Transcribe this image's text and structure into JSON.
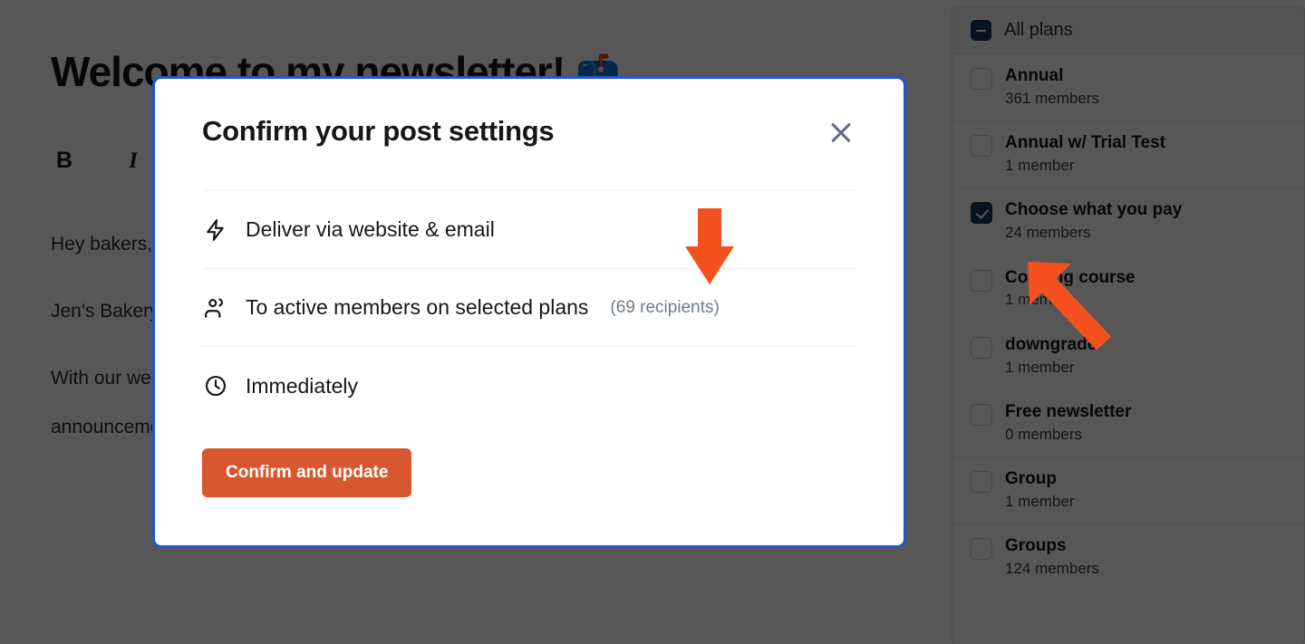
{
  "editor": {
    "post_title": "Welcome to my newsletter!",
    "post_title_emoji": "📫",
    "toolbar": {
      "bold": "B",
      "italic": "I"
    },
    "paragraphs": [
      "Hey bakers,",
      "Jen's Bakery is your go-to resource for simple recipes that get shared across the website.",
      "With our weekly newsletter, you'll never miss out on new recipes, discussions, or announcements."
    ]
  },
  "modal": {
    "title": "Confirm your post settings",
    "close_label": "Close",
    "settings": [
      {
        "icon": "lightning-bolt-icon",
        "label": "Deliver via website & email",
        "sub": ""
      },
      {
        "icon": "members-icon",
        "label": "To active members on selected plans",
        "sub": "(69 recipients)"
      },
      {
        "icon": "clock-icon",
        "label": "Immediately",
        "sub": ""
      }
    ],
    "confirm_button": "Confirm and update",
    "border_color": "#1f56d6",
    "button_color": "#d9572f"
  },
  "sidebar": {
    "header": {
      "label": "All plans",
      "checkbox_state": "indeterminate"
    },
    "plans": [
      {
        "name": "Annual",
        "members": "361 members",
        "checked": false
      },
      {
        "name": "Annual w/ Trial Test",
        "members": "1 member",
        "checked": false
      },
      {
        "name": "Choose what you pay",
        "members": "24 members",
        "checked": true
      },
      {
        "name": "Cooking course",
        "members": "1 member",
        "checked": false
      },
      {
        "name": "downgrade",
        "members": "1 member",
        "checked": false
      },
      {
        "name": "Free newsletter",
        "members": "0 members",
        "checked": false
      },
      {
        "name": "Group",
        "members": "1 member",
        "checked": false
      },
      {
        "name": "Groups",
        "members": "124 members",
        "checked": false
      }
    ],
    "checkbox_color": "#14375e"
  },
  "annotations": {
    "arrow_color": "#f4511e",
    "arrow_down_target": "(69 recipients)",
    "arrow_up_target": "Choose what you pay"
  }
}
